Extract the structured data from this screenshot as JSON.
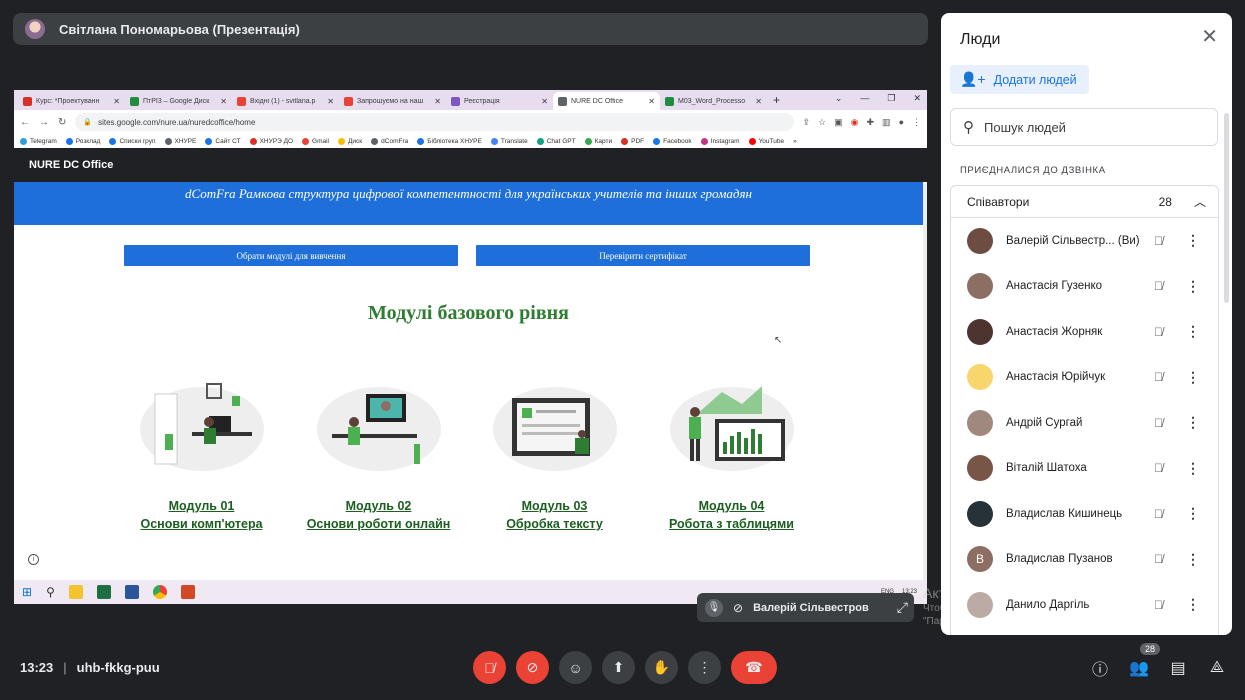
{
  "presenter": {
    "name": "Світлана Пономарьова (Презентація)"
  },
  "browser": {
    "tabs": [
      {
        "label": "Курс: *Проектуванн",
        "color": "#d93025"
      },
      {
        "label": "ПтРІ3 – Google Диск",
        "color": "#1e8e3e"
      },
      {
        "label": "Вхідні (1) - svitlana.p",
        "color": "#ea4335"
      },
      {
        "label": "Запрошуємо на наш",
        "color": "#ea4335"
      },
      {
        "label": "Реєстрація",
        "color": "#7e57c2"
      },
      {
        "label": "NURE DC Office",
        "color": "#5f6368"
      },
      {
        "label": "M03_Word_Processo",
        "color": "#1e8e3e"
      }
    ],
    "url": "sites.google.com/nure.ua/nuredcoffice/home",
    "bookmarks": [
      "Telegram",
      "Розклад",
      "Списки груп",
      "ХНУРЕ",
      "Сайт СТ",
      "ХНУРЭ ДО",
      "Gmail",
      "Диск",
      "dComFra",
      "Бібліотека ХНУРЕ",
      "Translate",
      "Chat GPT",
      "Карти",
      "PDF",
      "Facebook",
      "Instagram",
      "YouTube"
    ]
  },
  "site": {
    "header": "NURE DC Office",
    "banner": "dComFra Рамкова структура цифрової компетентності для українських учителів та інших громадян",
    "btn_modules": "Обрати модулі для вивчення",
    "btn_certificate": "Перевірити сертифікат",
    "section_title": "Модулі базового рівня",
    "modules": [
      {
        "num": "Модуль 01",
        "name": "Основи комп'ютера"
      },
      {
        "num": "Модуль 02",
        "name": "Основи роботи онлайн"
      },
      {
        "num": "Модуль 03",
        "name": "Обробка тексту"
      },
      {
        "num": "Модуль 04",
        "name": "Робота з таблицями"
      }
    ]
  },
  "taskbar": {
    "time": "13:23",
    "lang": "ENG"
  },
  "self_tile": {
    "name": "Валерій Сільвестров"
  },
  "watermark": {
    "line1": "Активация Windows",
    "line2": "Чтобы активировать Windows, перейдите в раздел",
    "line3": "\"Параметры\"."
  },
  "panel": {
    "title": "Люди",
    "add_people": "Додати людей",
    "search_placeholder": "Пошук людей",
    "section_label": "ПРИЄДНАЛИСЯ ДО ДЗВІНКА",
    "group_label": "Співавтори",
    "group_count": "28",
    "people": [
      {
        "name": "Валерій Сільвестр... (Ви)",
        "avatar_color": "#6d4c41"
      },
      {
        "name": "Анастасія Гузенко",
        "avatar_color": "#8d6e63"
      },
      {
        "name": "Анастасія Жорняк",
        "avatar_color": "#4e342e"
      },
      {
        "name": "Анастасія Юрійчук",
        "avatar_color": "#f9d56e"
      },
      {
        "name": "Андрій Сургай",
        "avatar_color": "#a1887f"
      },
      {
        "name": "Віталій Шатоха",
        "avatar_color": "#795548"
      },
      {
        "name": "Владислав Кишинець",
        "avatar_color": "#263238"
      },
      {
        "name": "Владислав Пузанов",
        "avatar_color": "#8d6e63",
        "initial": "В"
      },
      {
        "name": "Данило Даргіль",
        "avatar_color": "#bcaaa4"
      }
    ]
  },
  "bottom": {
    "time": "13:23",
    "meeting_code": "uhb-fkkg-puu",
    "people_count": "28"
  }
}
